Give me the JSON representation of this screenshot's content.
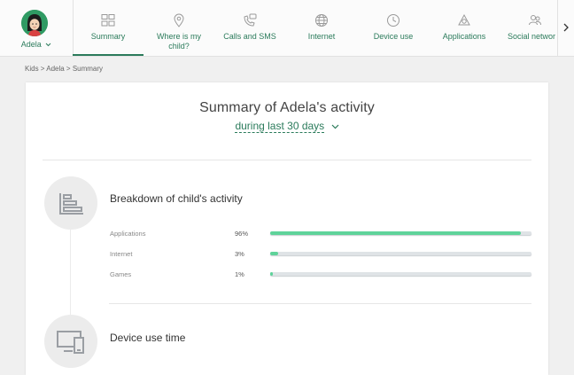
{
  "profile": {
    "name": "Adela"
  },
  "nav": {
    "tabs": [
      {
        "label": "Summary",
        "icon": "summary-icon",
        "active": true
      },
      {
        "label": "Where is my child?",
        "icon": "location-pin-icon",
        "active": false
      },
      {
        "label": "Calls and SMS",
        "icon": "phone-sms-icon",
        "active": false
      },
      {
        "label": "Internet",
        "icon": "globe-icon",
        "active": false
      },
      {
        "label": "Device use",
        "icon": "clock-icon",
        "active": false
      },
      {
        "label": "Applications",
        "icon": "applications-icon",
        "active": false
      },
      {
        "label": "Social networ",
        "icon": "people-icon",
        "active": false
      }
    ]
  },
  "breadcrumb": "Kids > Adela > Summary",
  "summary": {
    "title": "Summary of Adela's activity",
    "period": "during last 30 days"
  },
  "breakdown": {
    "title": "Breakdown of child's activity",
    "rows": [
      {
        "label": "Applications",
        "percent": "96%",
        "value": 0.96
      },
      {
        "label": "Internet",
        "percent": "3%",
        "value": 0.03
      },
      {
        "label": "Games",
        "percent": "1%",
        "value": 0.01
      }
    ]
  },
  "device_use": {
    "title": "Device use time"
  },
  "colors": {
    "accent": "#2b7b5b",
    "bar_fill": "#5fd39a",
    "bar_track": "#dfe3e6"
  }
}
